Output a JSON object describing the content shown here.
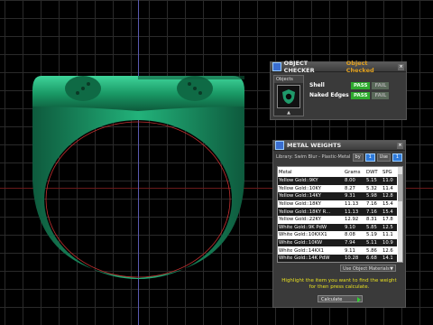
{
  "object_checker": {
    "title": "OBJECT CHECKER",
    "tab_title": "Object Checked",
    "thumb_caption": "Objects",
    "checks": [
      {
        "label": "Shell",
        "pass": "PASS",
        "fail": "FAIL"
      },
      {
        "label": "Naked Edges",
        "pass": "PASS",
        "fail": "FAIL"
      }
    ],
    "colors": {
      "pass": "#2faa2f",
      "accent": "#e0a020"
    }
  },
  "metal_weights": {
    "title": "METAL WEIGHTS",
    "library": "Library: Swim Blur - Plastic-Metal",
    "columns": [
      "Metal",
      "Grams",
      "DWT",
      "SPG"
    ],
    "rows": [
      {
        "metal": "Yellow Gold::9KY",
        "grams": "8.00",
        "dwt": "5.15",
        "spg": "11.0"
      },
      {
        "metal": "Yellow Gold::10KY",
        "grams": "8.27",
        "dwt": "5.32",
        "spg": "11.4"
      },
      {
        "metal": "Yellow Gold::14KY",
        "grams": "9.31",
        "dwt": "5.98",
        "spg": "12.8"
      },
      {
        "metal": "Yellow Gold::18KY",
        "grams": "11.13",
        "dwt": "7.16",
        "spg": "15.4"
      },
      {
        "metal": "Yellow Gold::18KY R...",
        "grams": "11.13",
        "dwt": "7.16",
        "spg": "15.4"
      },
      {
        "metal": "Yellow Gold::22KY",
        "grams": "12.92",
        "dwt": "8.31",
        "spg": "17.8"
      },
      {
        "metal": "White Gold::9K PdW",
        "grams": "9.10",
        "dwt": "5.85",
        "spg": "12.5"
      },
      {
        "metal": "White Gold::10KXX1",
        "grams": "8.08",
        "dwt": "5.19",
        "spg": "11.1"
      },
      {
        "metal": "White Gold::10KW",
        "grams": "7.94",
        "dwt": "5.11",
        "spg": "10.9"
      },
      {
        "metal": "White Gold::14KX1",
        "grams": "9.11",
        "dwt": "5.86",
        "spg": "12.6"
      },
      {
        "metal": "White Gold::14K PdW",
        "grams": "10.28",
        "dwt": "6.68",
        "spg": "14.1"
      }
    ],
    "material_select": "Use Object Materials",
    "help_text_line1": "Highlight the item you want to find the weight",
    "help_text_line2": "for then press calculate.",
    "calculate_label": "Calculate",
    "buttons": [
      "by",
      "1",
      "Use",
      "1"
    ]
  },
  "viewport": {
    "colors": {
      "ring_green": "#1f9a6a",
      "grid": "#2a2a2a",
      "axis_x": "#6a1a1a",
      "axis_y": "#5b5bb0"
    }
  }
}
